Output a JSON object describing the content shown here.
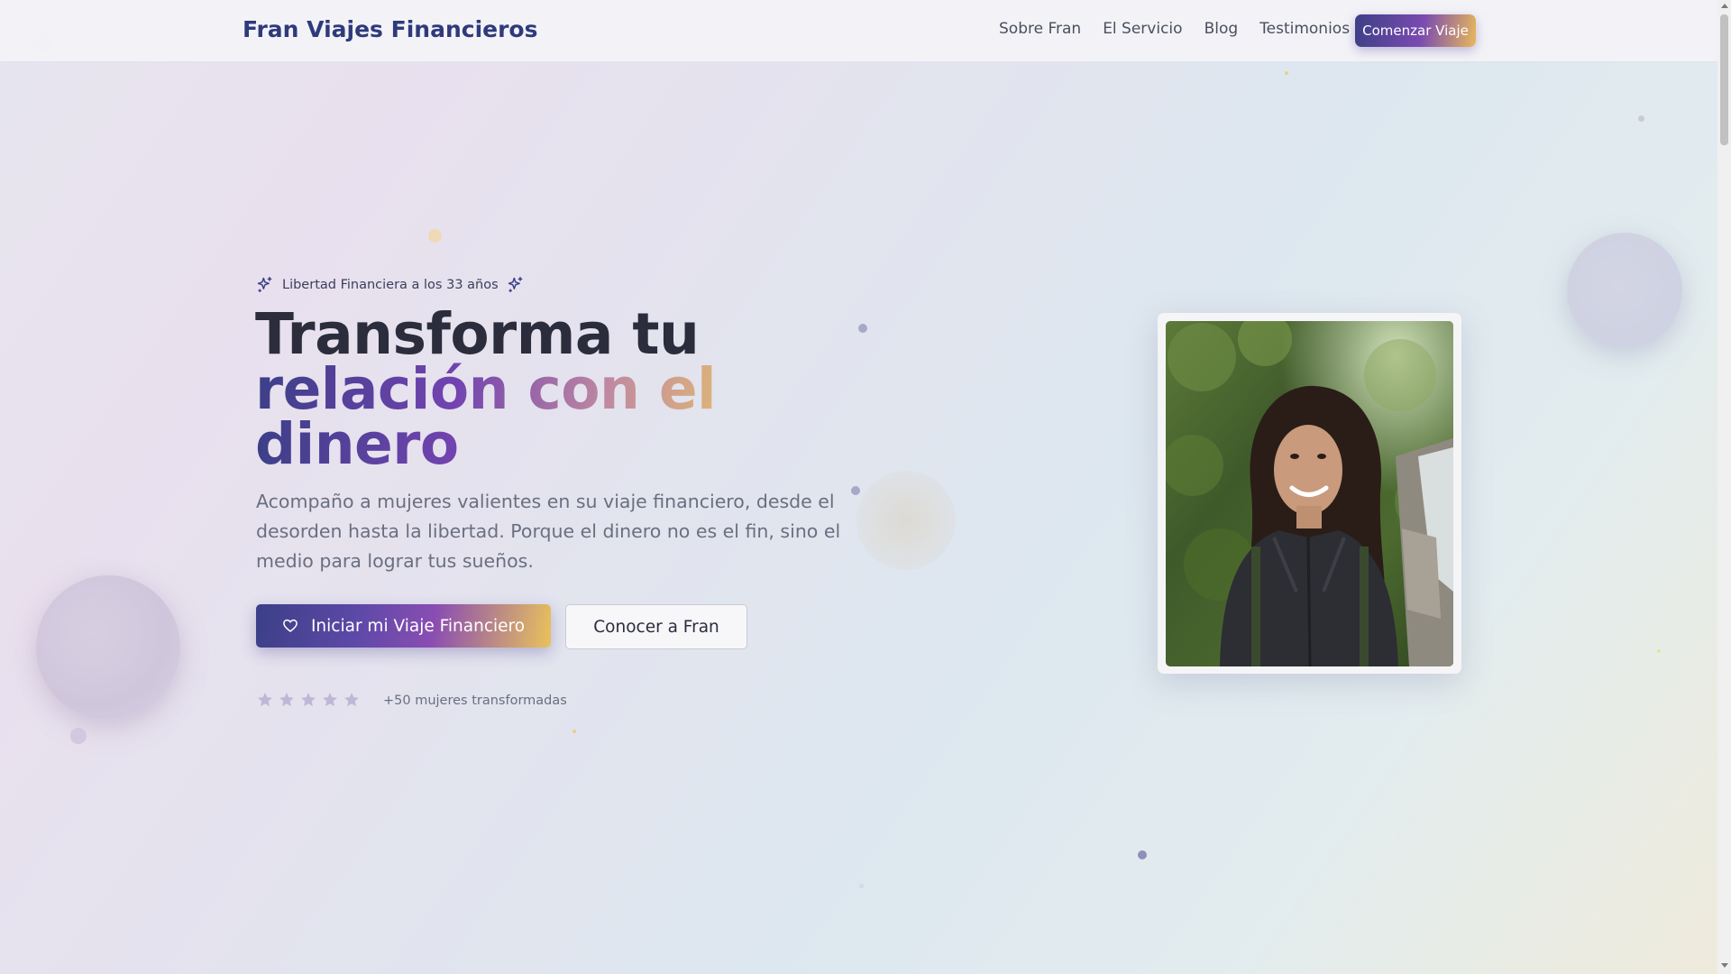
{
  "nav": {
    "brand": "Fran Viajes Financieros",
    "links": [
      "Sobre Fran",
      "El Servicio",
      "Blog",
      "Testimonios"
    ],
    "cta": "Comenzar Viaje"
  },
  "hero": {
    "tagline": "Libertad Financiera a los 33 años",
    "headline_line1": "Transforma tu",
    "headline_line2": "relación con el",
    "headline_line3": "dinero",
    "subtitle": "Acompaño a mujeres valientes en su viaje financiero, desde el desorden hasta la libertad. Porque el dinero no es el fin, sino el medio para lograr tus sueños.",
    "primary_button": "Iniciar mi Viaje Financiero",
    "secondary_button": "Conocer a Fran",
    "rating_stars": 5,
    "social_proof": "+50 mujeres transformadas"
  },
  "colors": {
    "brand": "#2f3a7c",
    "gradient_start": "#3b3f87",
    "gradient_mid": "#7243b0",
    "gradient_end": "#e8c46a"
  },
  "icons": {
    "tagline_left": "sparkles-icon",
    "tagline_right": "sparkles-icon",
    "primary_button": "heart-icon",
    "rating": "star-icon"
  }
}
